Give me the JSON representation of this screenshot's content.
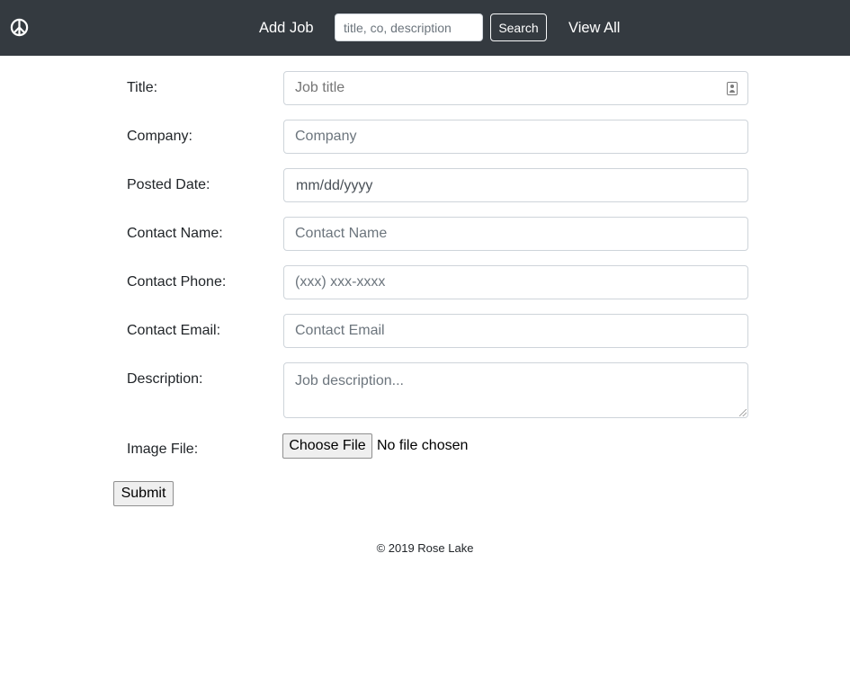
{
  "navbar": {
    "logo_icon": "peace-sign-icon",
    "add_job_label": "Add Job",
    "search_placeholder": "title, co, description",
    "search_button_label": "Search",
    "view_all_label": "View All",
    "background_color": "#343a40"
  },
  "form": {
    "fields": [
      {
        "label": "Title:",
        "placeholder": "Job title",
        "value": ""
      },
      {
        "label": "Company:",
        "placeholder": "Company",
        "value": ""
      },
      {
        "label": "Posted Date:",
        "placeholder": "",
        "value": "mm/dd/yyyy"
      },
      {
        "label": "Contact Name:",
        "placeholder": "Contact Name",
        "value": ""
      },
      {
        "label": "Contact Phone:",
        "placeholder": "(xxx) xxx-xxxx",
        "value": ""
      },
      {
        "label": "Contact Email:",
        "placeholder": "Contact Email",
        "value": ""
      },
      {
        "label": "Description:",
        "placeholder": "Job description...",
        "value": ""
      }
    ],
    "image_file": {
      "label": "Image File:",
      "button_label": "Choose File",
      "status": "No file chosen"
    },
    "submit_label": "Submit"
  },
  "footer": {
    "text": "© 2019 Rose Lake"
  }
}
